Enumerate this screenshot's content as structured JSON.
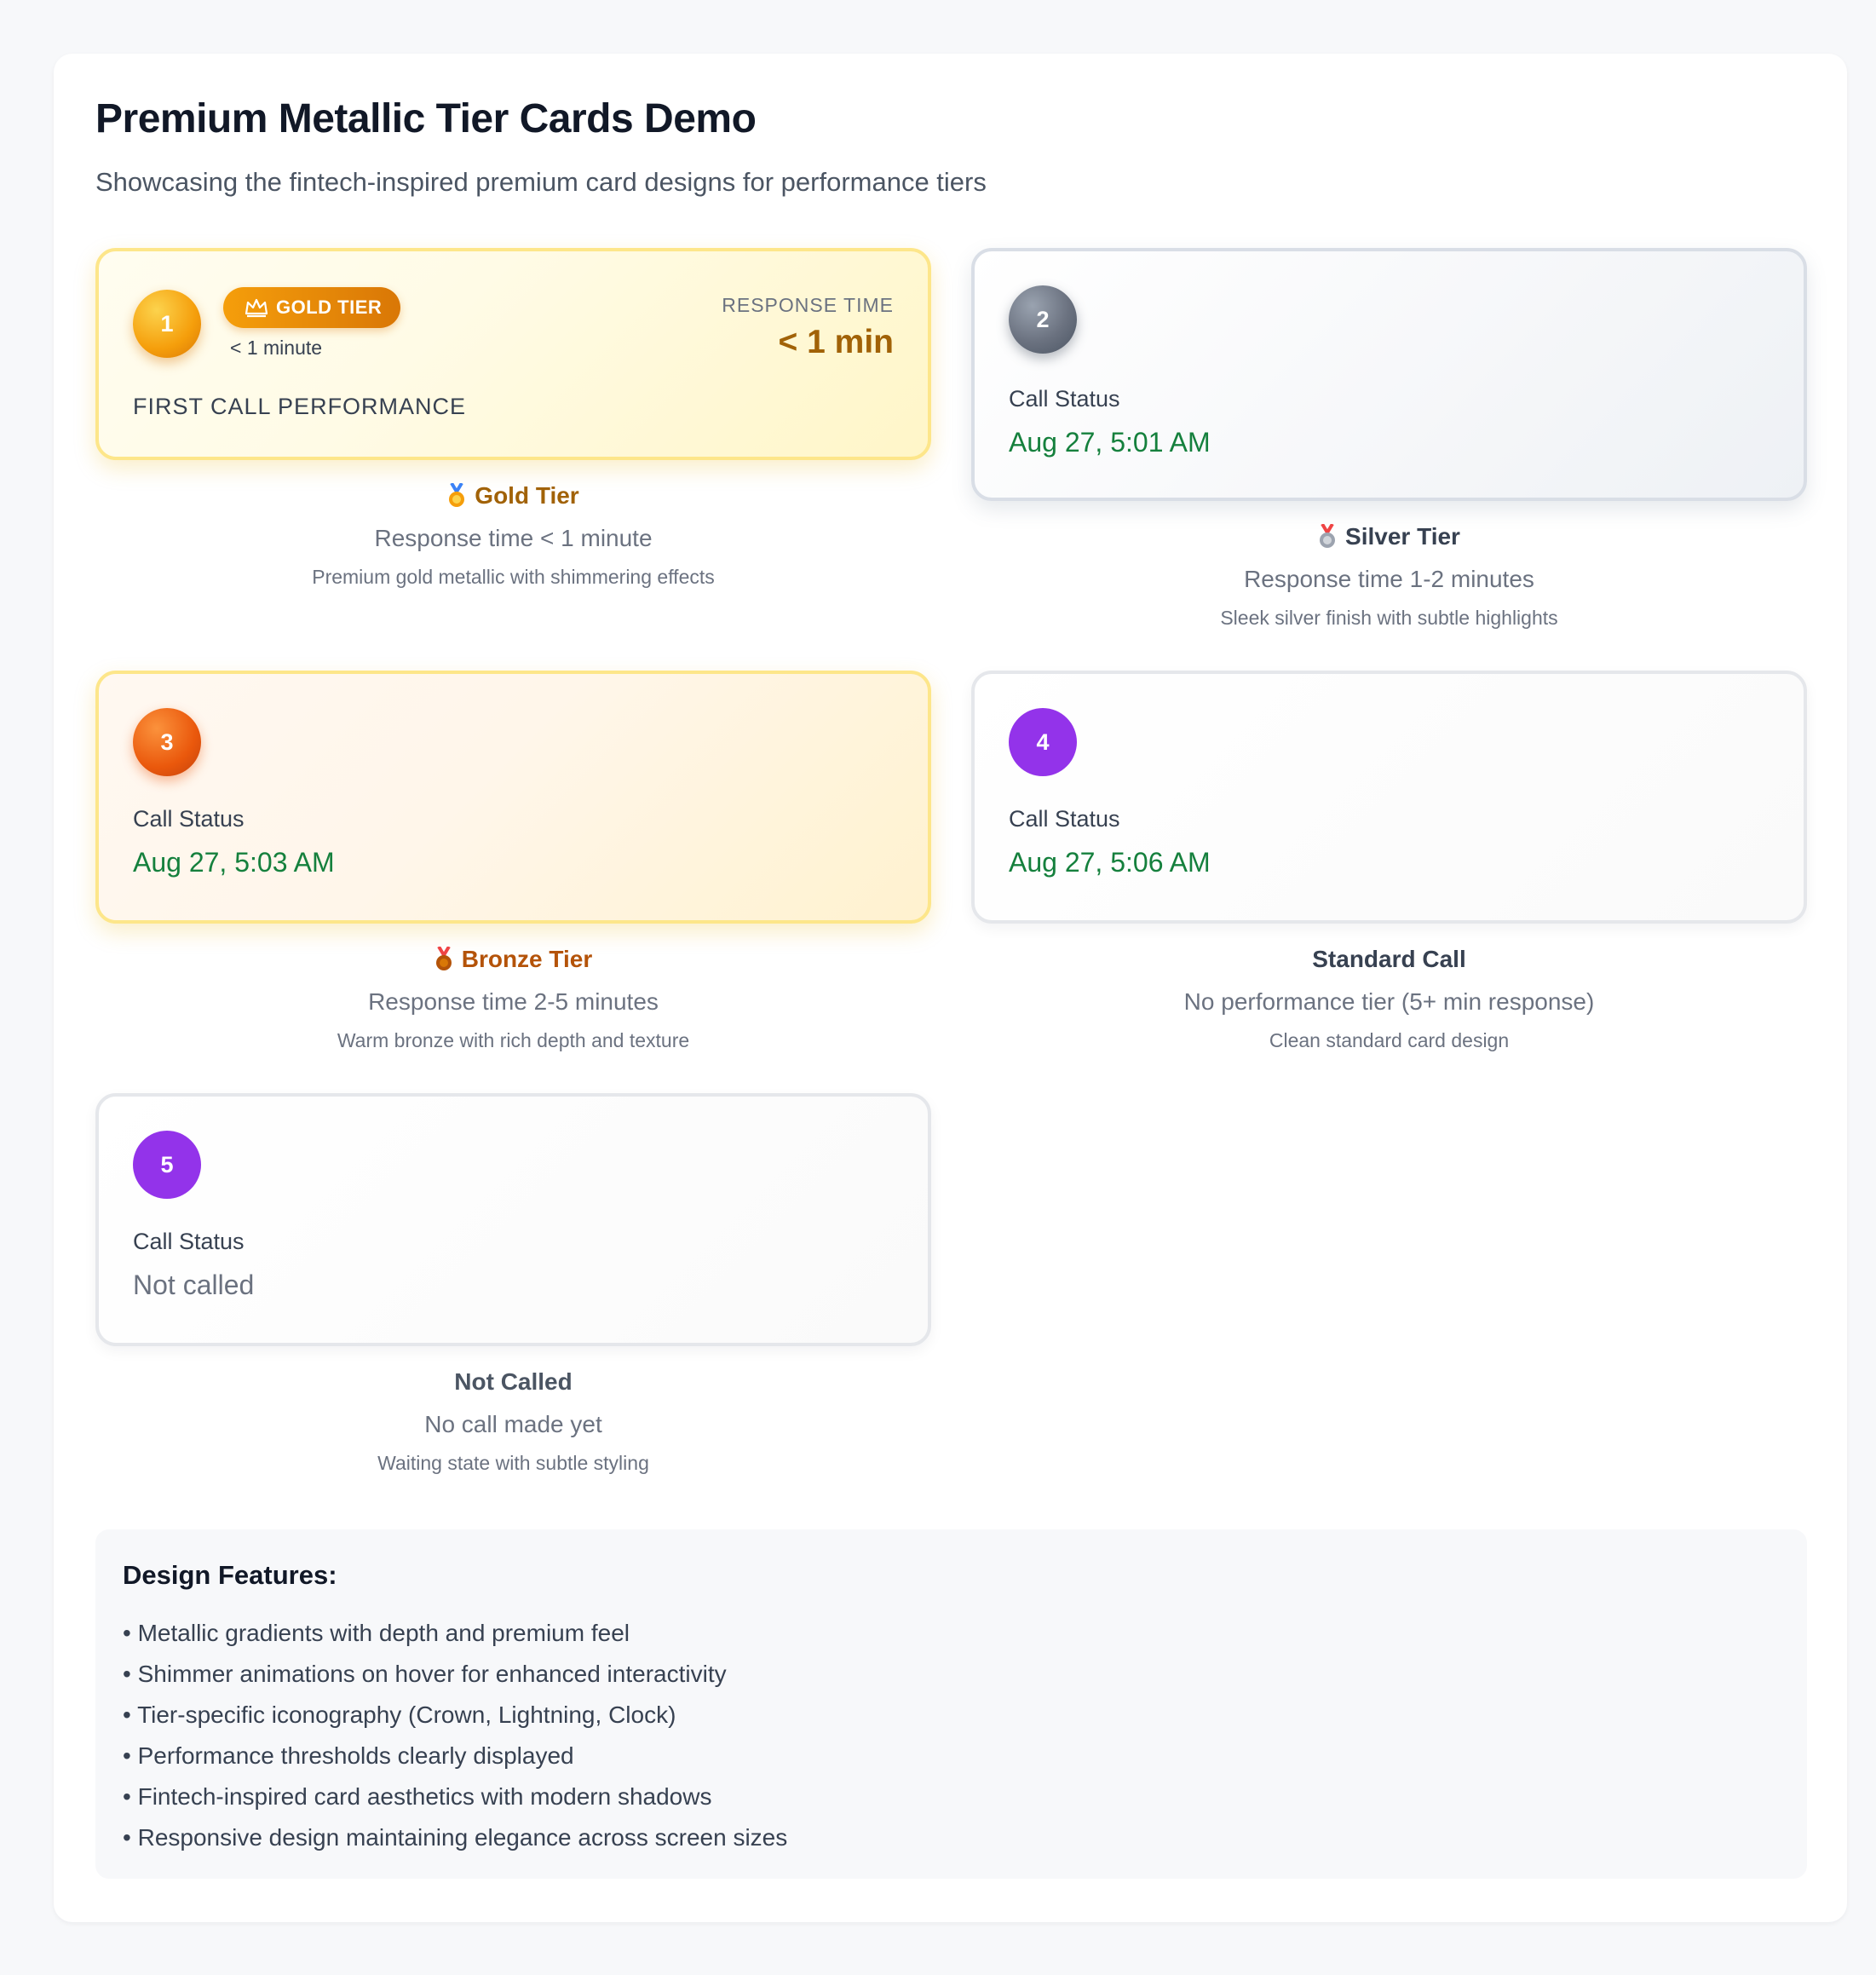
{
  "page": {
    "title": "Premium Metallic Tier Cards Demo",
    "subtitle": "Showcasing the fintech-inspired premium card designs for performance tiers"
  },
  "cards": [
    {
      "rank": "1",
      "tier_pill": "GOLD TIER",
      "tier_pill_icon": "crown-icon",
      "note": "< 1 minute",
      "response_label": "RESPONSE TIME",
      "response_value": "< 1 min",
      "performance_label": "FIRST CALL PERFORMANCE",
      "caption": {
        "title": "Gold Tier",
        "line1": "Response time < 1 minute",
        "line2": "Premium gold metallic with shimmering effects",
        "color": "#a16207",
        "medal_icon": "gold-medal-icon"
      }
    },
    {
      "rank": "2",
      "status_label": "Call Status",
      "status_value": "Aug 27, 5:01 AM",
      "caption": {
        "title": "Silver Tier",
        "line1": "Response time 1-2 minutes",
        "line2": "Sleek silver finish with subtle highlights",
        "color": "#374151",
        "medal_icon": "silver-medal-icon"
      }
    },
    {
      "rank": "3",
      "status_label": "Call Status",
      "status_value": "Aug 27, 5:03 AM",
      "caption": {
        "title": "Bronze Tier",
        "line1": "Response time 2-5 minutes",
        "line2": "Warm bronze with rich depth and texture",
        "color": "#b45309",
        "medal_icon": "bronze-medal-icon"
      }
    },
    {
      "rank": "4",
      "status_label": "Call Status",
      "status_value": "Aug 27, 5:06 AM",
      "caption": {
        "title": "Standard Call",
        "line1": "No performance tier (5+ min response)",
        "line2": "Clean standard card design",
        "color": "#374151"
      }
    },
    {
      "rank": "5",
      "status_label": "Call Status",
      "status_value": "Not called",
      "caption": {
        "title": "Not Called",
        "line1": "No call made yet",
        "line2": "Waiting state with subtle styling",
        "color": "#4b5563"
      }
    }
  ],
  "features": {
    "title": "Design Features:",
    "items": [
      "Metallic gradients with depth and premium feel",
      "Shimmer animations on hover for enhanced interactivity",
      "Tier-specific iconography (Crown, Lightning, Clock)",
      "Performance thresholds clearly displayed",
      "Fintech-inspired card aesthetics with modern shadows",
      "Responsive design maintaining elegance across screen sizes"
    ]
  },
  "colors": {
    "gold_accent": "#d97706",
    "bronze_accent": "#ea580c",
    "silver_accent": "#6b7280",
    "standard_accent": "#9333ea",
    "status_green": "#15803d"
  }
}
